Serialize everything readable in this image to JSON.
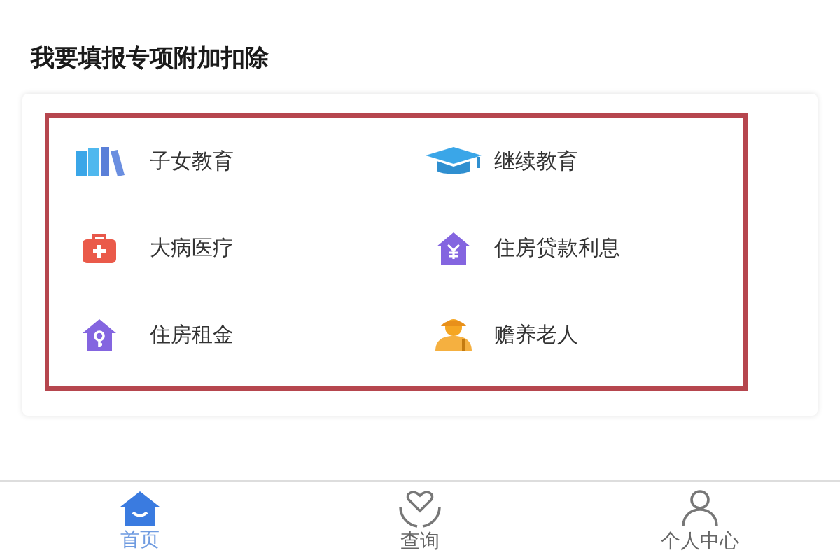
{
  "title": "我要填报专项附加扣除",
  "deductions": [
    {
      "label": "子女教育",
      "kind": "books"
    },
    {
      "label": "继续教育",
      "kind": "cap"
    },
    {
      "label": "大病医疗",
      "kind": "medkit"
    },
    {
      "label": "住房贷款利息",
      "kind": "loan"
    },
    {
      "label": "住房租金",
      "kind": "rent"
    },
    {
      "label": "赡养老人",
      "kind": "elder"
    }
  ],
  "tabbar": [
    {
      "label": "首页",
      "kind": "home",
      "selected": true
    },
    {
      "label": "查询",
      "kind": "query",
      "selected": false
    },
    {
      "label": "个人中心",
      "kind": "person",
      "selected": false
    }
  ]
}
